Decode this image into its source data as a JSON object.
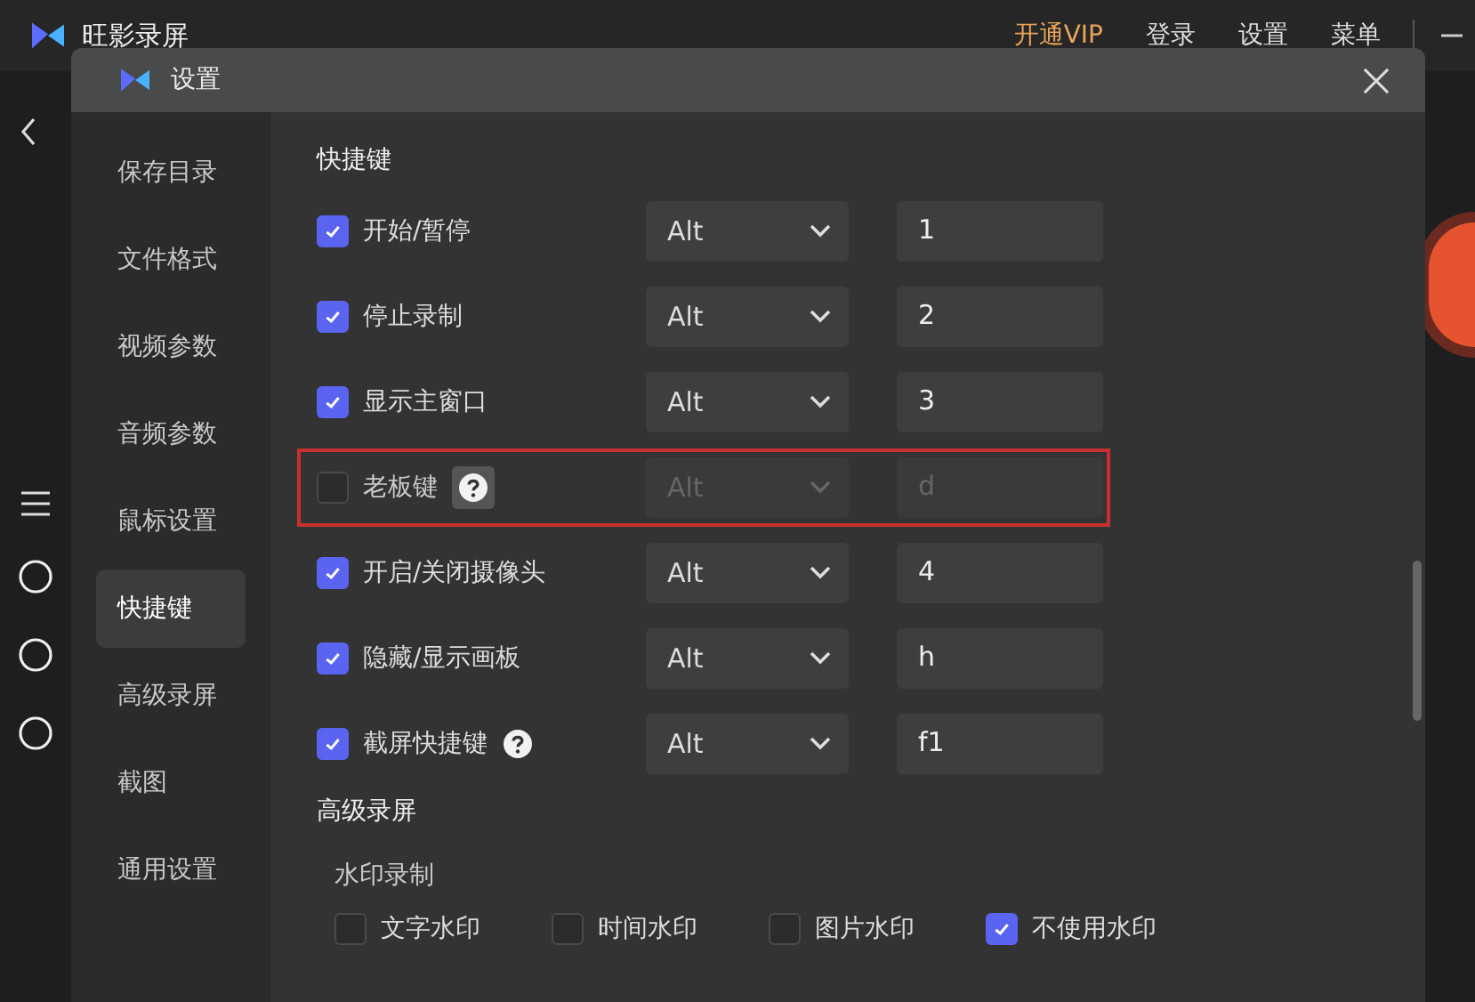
{
  "app": {
    "title": "旺影录屏",
    "menu": [
      {
        "label": "开通VIP",
        "kind": "vip"
      },
      {
        "label": "登录",
        "kind": "plain"
      },
      {
        "label": "设置",
        "kind": "plain"
      },
      {
        "label": "菜单",
        "kind": "plain"
      }
    ]
  },
  "dialog": {
    "title": "设置",
    "sidebar": {
      "items": [
        {
          "label": "保存目录",
          "selected": false
        },
        {
          "label": "文件格式",
          "selected": false
        },
        {
          "label": "视频参数",
          "selected": false
        },
        {
          "label": "音频参数",
          "selected": false
        },
        {
          "label": "鼠标设置",
          "selected": false
        },
        {
          "label": "快捷键",
          "selected": true
        },
        {
          "label": "高级录屏",
          "selected": false
        },
        {
          "label": "截图",
          "selected": false
        },
        {
          "label": "通用设置",
          "selected": false
        }
      ]
    },
    "shortcuts": {
      "heading": "快捷键",
      "rows": [
        {
          "label": "开始/暂停",
          "checked": true,
          "help": false,
          "highlighted": false,
          "modifier": "Alt",
          "key": "1"
        },
        {
          "label": "停止录制",
          "checked": true,
          "help": false,
          "highlighted": false,
          "modifier": "Alt",
          "key": "2"
        },
        {
          "label": "显示主窗口",
          "checked": true,
          "help": false,
          "highlighted": false,
          "modifier": "Alt",
          "key": "3"
        },
        {
          "label": "老板键",
          "checked": false,
          "help": true,
          "highlighted": true,
          "modifier": "Alt",
          "key": "d"
        },
        {
          "label": "开启/关闭摄像头",
          "checked": true,
          "help": false,
          "highlighted": false,
          "modifier": "Alt",
          "key": "4"
        },
        {
          "label": "隐藏/显示画板",
          "checked": true,
          "help": false,
          "highlighted": false,
          "modifier": "Alt",
          "key": "h"
        },
        {
          "label": "截屏快捷键",
          "checked": true,
          "help": true,
          "highlighted": false,
          "modifier": "Alt",
          "key": "f1"
        }
      ]
    },
    "advanced": {
      "heading": "高级录屏",
      "subheading": "水印录制",
      "options": [
        {
          "label": "文字水印",
          "checked": false
        },
        {
          "label": "时间水印",
          "checked": false
        },
        {
          "label": "图片水印",
          "checked": false
        },
        {
          "label": "不使用水印",
          "checked": true
        }
      ]
    }
  }
}
